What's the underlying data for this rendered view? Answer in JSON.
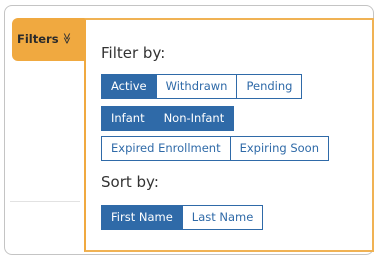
{
  "filters_tab": {
    "label": "Filters",
    "icon": "double-chevron-down-icon",
    "chevron_glyph": "≫"
  },
  "popover": {
    "filter_by_label": "Filter by:",
    "sort_by_label": "Sort by:",
    "status_buttons": [
      {
        "label": "Active",
        "active": true
      },
      {
        "label": "Withdrawn",
        "active": false
      },
      {
        "label": "Pending",
        "active": false
      }
    ],
    "age_buttons": [
      {
        "label": "Infant",
        "active": true
      },
      {
        "label": "Non-Infant",
        "active": true
      }
    ],
    "enrollment_buttons": [
      {
        "label": "Expired Enrollment",
        "active": false
      },
      {
        "label": "Expiring Soon",
        "active": false
      }
    ],
    "sort_buttons": [
      {
        "label": "First Name",
        "active": true
      },
      {
        "label": "Last Name",
        "active": false
      }
    ]
  },
  "colors": {
    "accent": "#f0a940",
    "primary": "#2f6aa8",
    "text": "#333333"
  }
}
